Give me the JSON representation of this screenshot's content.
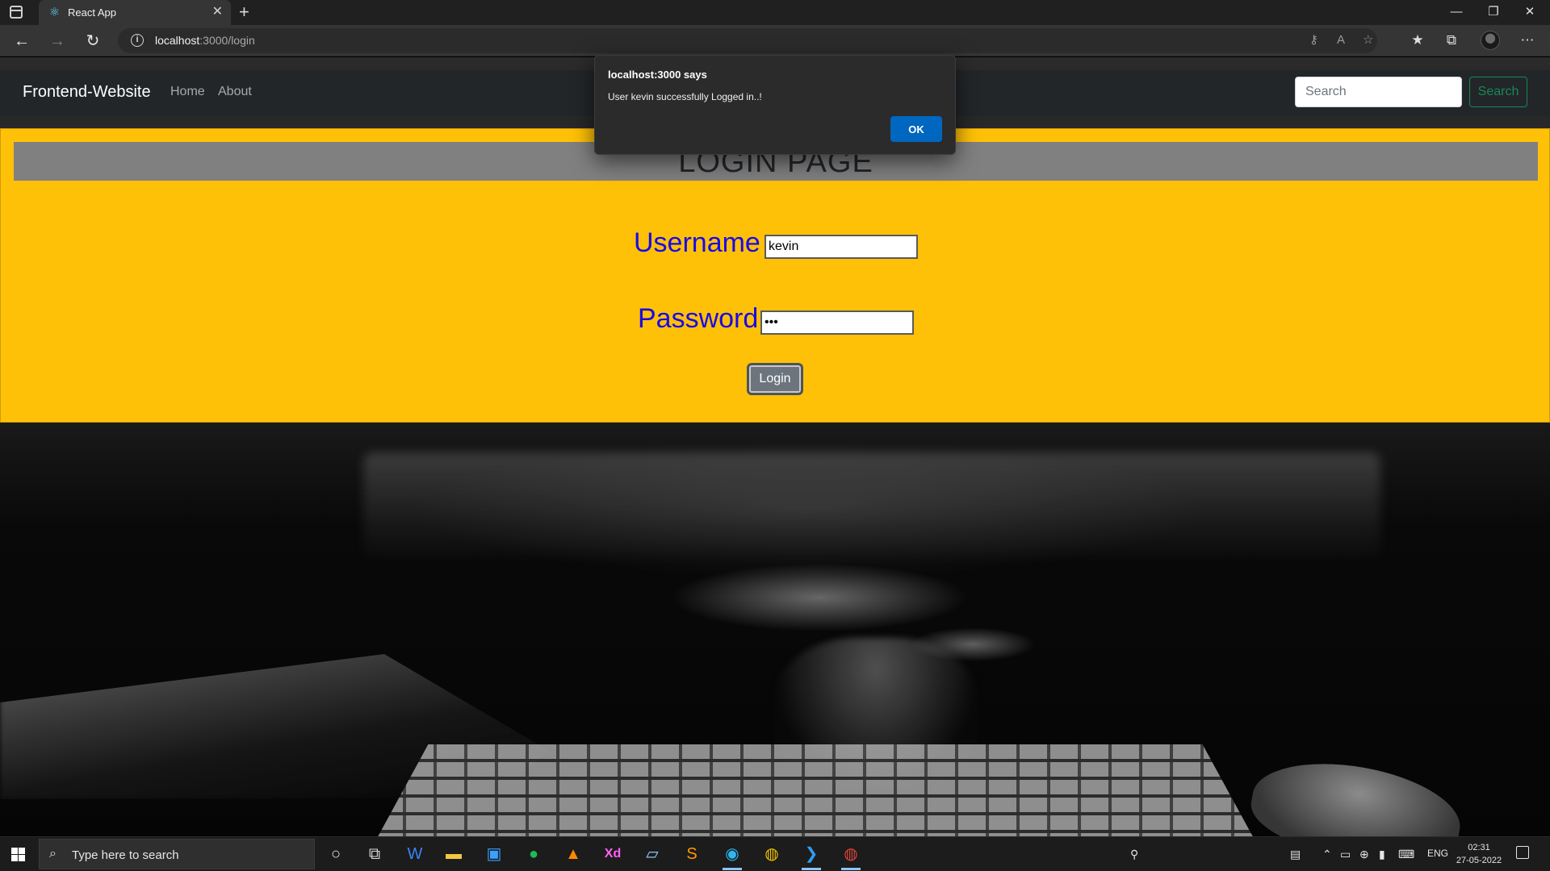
{
  "browser": {
    "tab_title": "React App",
    "tab_close": "✕",
    "new_tab": "+",
    "url_host": "localhost",
    "url_path": ":3000/login",
    "window_controls": {
      "minimize": "—",
      "restore": "❐",
      "close": "✕"
    }
  },
  "site": {
    "brand": "Frontend-Website",
    "nav_links": [
      "Home",
      "About"
    ],
    "search_placeholder": "Search",
    "search_button": "Search"
  },
  "login": {
    "title": "LOGIN PAGE",
    "username_label": "Username :",
    "username_value": "kevin",
    "password_label": "Password :",
    "password_value": "abc",
    "login_button": "Login",
    "card_color": "#ffc107",
    "label_color": "#1a0ae6"
  },
  "alert": {
    "origin": "localhost:3000 says",
    "message": "User kevin successfully Logged in..!",
    "ok_button": "OK"
  },
  "taskbar": {
    "search_placeholder": "Type here to search",
    "apps": [
      "cortana-icon",
      "task-view-icon",
      "word-icon",
      "file-explorer-icon",
      "store-icon",
      "spotify-icon",
      "vlc-icon",
      "adobe-xd-icon",
      "notepad-icon",
      "sublime-icon",
      "edge-icon",
      "chrome-icon",
      "vscode-icon",
      "chrome-dev-icon"
    ],
    "language": "ENG",
    "time": "02:31",
    "date": "27-05-2022"
  }
}
